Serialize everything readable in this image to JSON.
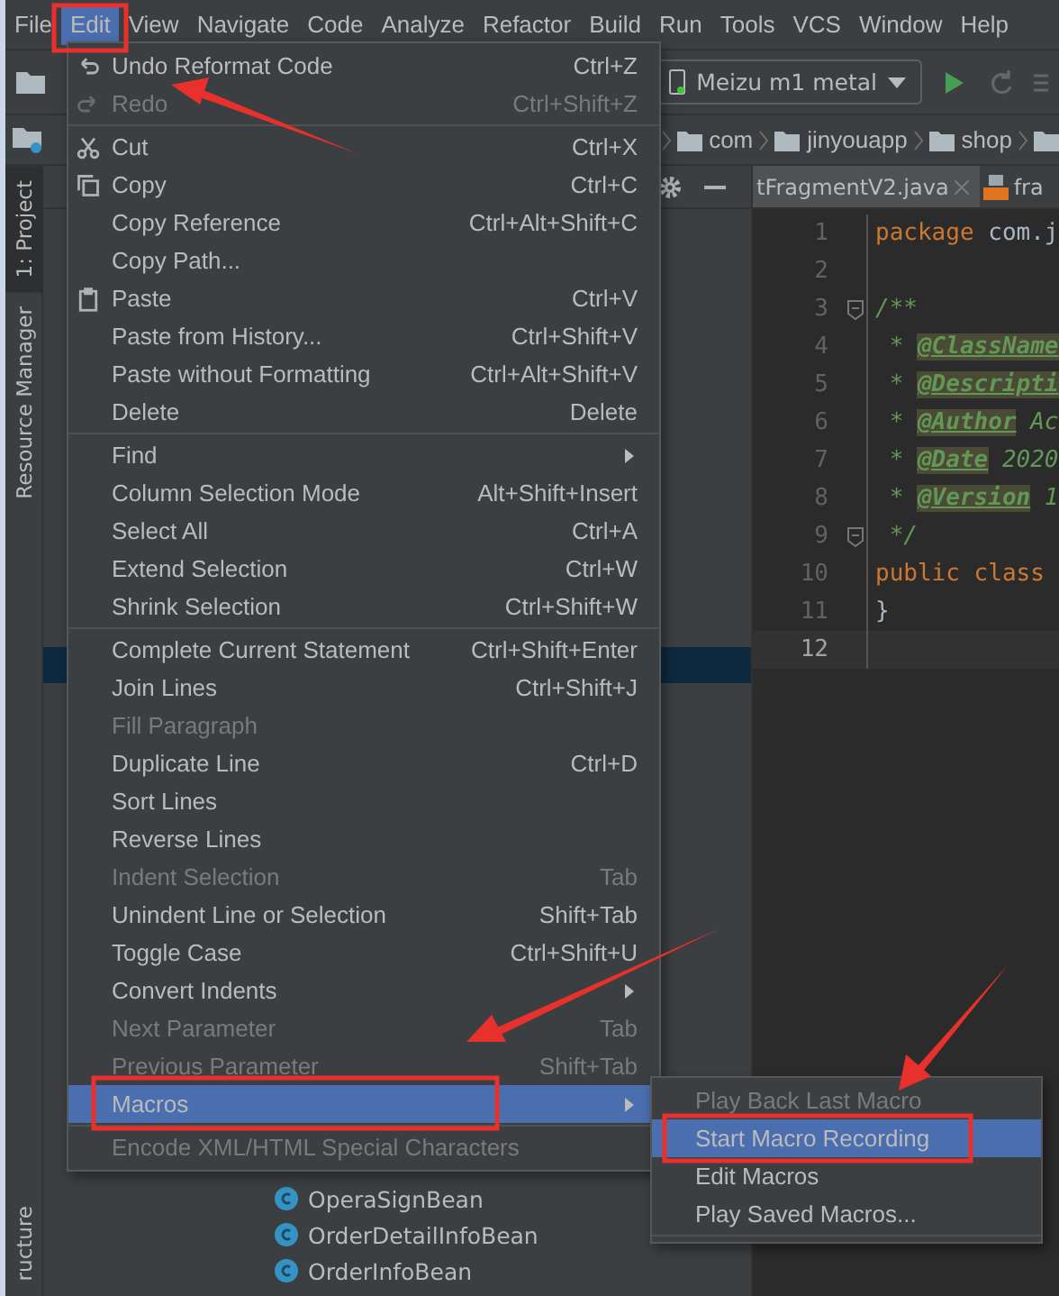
{
  "menu_bar": [
    {
      "label": "File",
      "selected": false
    },
    {
      "label": "Edit",
      "selected": true
    },
    {
      "label": "View",
      "selected": false
    },
    {
      "label": "Navigate",
      "selected": false
    },
    {
      "label": "Code",
      "selected": false
    },
    {
      "label": "Analyze",
      "selected": false
    },
    {
      "label": "Refactor",
      "selected": false
    },
    {
      "label": "Build",
      "selected": false
    },
    {
      "label": "Run",
      "selected": false
    },
    {
      "label": "Tools",
      "selected": false
    },
    {
      "label": "VCS",
      "selected": false
    },
    {
      "label": "Window",
      "selected": false
    },
    {
      "label": "Help",
      "selected": false
    }
  ],
  "toolbar": {
    "device": "Meizu m1 metal"
  },
  "breadcrumbs": [
    "com",
    "jinyouapp",
    "shop"
  ],
  "tool_strip": {
    "top": [
      {
        "label": "1: Project",
        "selected": true
      },
      {
        "label": "Resource Manager",
        "selected": false
      }
    ],
    "bottom": [
      {
        "label": "ructure",
        "selected": false
      }
    ]
  },
  "project_panel": {
    "highlighted_row": {
      "selected": true
    },
    "classes": [
      {
        "label": "OperaSignBean"
      },
      {
        "label": "OrderDetailInfoBean"
      },
      {
        "label": "OrderInfoBean"
      }
    ]
  },
  "editor": {
    "tabs": [
      {
        "label": "tFragmentV2.java",
        "selected": true,
        "closable": true,
        "kind": "java"
      },
      {
        "label": "fra",
        "selected": false,
        "closable": false,
        "kind": "layout"
      }
    ],
    "lines": [
      {
        "number": "1",
        "current": false,
        "segments": [
          {
            "kind": "keyword",
            "text": "package"
          },
          {
            "kind": "plain",
            "text": " com.j"
          }
        ]
      },
      {
        "number": "2",
        "current": false
      },
      {
        "number": "3",
        "current": false,
        "fold": true,
        "segments": [
          {
            "kind": "comment",
            "text": "/**"
          }
        ]
      },
      {
        "number": "4",
        "current": false,
        "segments": [
          {
            "kind": "comment",
            "text": " * "
          },
          {
            "kind": "tag",
            "text": "@ClassName"
          }
        ]
      },
      {
        "number": "5",
        "current": false,
        "segments": [
          {
            "kind": "comment",
            "text": " * "
          },
          {
            "kind": "tag",
            "text": "@Descripti"
          }
        ]
      },
      {
        "number": "6",
        "current": false,
        "segments": [
          {
            "kind": "comment",
            "text": " * "
          },
          {
            "kind": "tag",
            "text": "@Author"
          },
          {
            "kind": "comment",
            "text": " Ac"
          }
        ]
      },
      {
        "number": "7",
        "current": false,
        "segments": [
          {
            "kind": "comment",
            "text": " * "
          },
          {
            "kind": "tag",
            "text": "@Date"
          },
          {
            "kind": "comment",
            "text": " 2020"
          }
        ]
      },
      {
        "number": "8",
        "current": false,
        "segments": [
          {
            "kind": "comment",
            "text": " * "
          },
          {
            "kind": "tag",
            "text": "@Version"
          },
          {
            "kind": "comment",
            "text": " 1"
          }
        ]
      },
      {
        "number": "9",
        "current": false,
        "fold": true,
        "segments": [
          {
            "kind": "comment",
            "text": " */"
          }
        ]
      },
      {
        "number": "10",
        "current": false,
        "segments": [
          {
            "kind": "keyword",
            "text": "public class"
          }
        ]
      },
      {
        "number": "11",
        "current": false,
        "segments": [
          {
            "kind": "plain",
            "text": "}"
          }
        ]
      },
      {
        "number": "12",
        "current": true
      }
    ]
  },
  "edit_menu": {
    "items": [
      {
        "kind": "item",
        "label": "Undo Reformat Code",
        "shortcut": "Ctrl+Z",
        "disabled": false,
        "selected": false,
        "submenu": false
      },
      {
        "kind": "item",
        "label": "Redo",
        "shortcut": "Ctrl+Shift+Z",
        "disabled": true,
        "selected": false,
        "submenu": false
      },
      {
        "kind": "separator"
      },
      {
        "kind": "item",
        "label": "Cut",
        "shortcut": "Ctrl+X",
        "disabled": false,
        "selected": false,
        "submenu": false
      },
      {
        "kind": "item",
        "label": "Copy",
        "shortcut": "Ctrl+C",
        "disabled": false,
        "selected": false,
        "submenu": false
      },
      {
        "kind": "item",
        "label": "Copy Reference",
        "shortcut": "Ctrl+Alt+Shift+C",
        "disabled": false,
        "selected": false,
        "submenu": false
      },
      {
        "kind": "item",
        "label": "Copy Path...",
        "disabled": false,
        "selected": false,
        "submenu": false
      },
      {
        "kind": "item",
        "label": "Paste",
        "shortcut": "Ctrl+V",
        "disabled": false,
        "selected": false,
        "submenu": false
      },
      {
        "kind": "item",
        "label": "Paste from History...",
        "shortcut": "Ctrl+Shift+V",
        "disabled": false,
        "selected": false,
        "submenu": false
      },
      {
        "kind": "item",
        "label": "Paste without Formatting",
        "shortcut": "Ctrl+Alt+Shift+V",
        "disabled": false,
        "selected": false,
        "submenu": false
      },
      {
        "kind": "item",
        "label": "Delete",
        "shortcut": "Delete",
        "disabled": false,
        "selected": false,
        "submenu": false
      },
      {
        "kind": "separator"
      },
      {
        "kind": "item",
        "label": "Find",
        "disabled": false,
        "selected": false,
        "submenu": true
      },
      {
        "kind": "item",
        "label": "Column Selection Mode",
        "shortcut": "Alt+Shift+Insert",
        "disabled": false,
        "selected": false,
        "submenu": false
      },
      {
        "kind": "item",
        "label": "Select All",
        "shortcut": "Ctrl+A",
        "disabled": false,
        "selected": false,
        "submenu": false
      },
      {
        "kind": "item",
        "label": "Extend Selection",
        "shortcut": "Ctrl+W",
        "disabled": false,
        "selected": false,
        "submenu": false
      },
      {
        "kind": "item",
        "label": "Shrink Selection",
        "shortcut": "Ctrl+Shift+W",
        "disabled": false,
        "selected": false,
        "submenu": false
      },
      {
        "kind": "separator"
      },
      {
        "kind": "item",
        "label": "Complete Current Statement",
        "shortcut": "Ctrl+Shift+Enter",
        "disabled": false,
        "selected": false,
        "submenu": false
      },
      {
        "kind": "item",
        "label": "Join Lines",
        "shortcut": "Ctrl+Shift+J",
        "disabled": false,
        "selected": false,
        "submenu": false
      },
      {
        "kind": "item",
        "label": "Fill Paragraph",
        "disabled": true,
        "selected": false,
        "submenu": false
      },
      {
        "kind": "item",
        "label": "Duplicate Line",
        "shortcut": "Ctrl+D",
        "disabled": false,
        "selected": false,
        "submenu": false
      },
      {
        "kind": "item",
        "label": "Sort Lines",
        "disabled": false,
        "selected": false,
        "submenu": false
      },
      {
        "kind": "item",
        "label": "Reverse Lines",
        "disabled": false,
        "selected": false,
        "submenu": false
      },
      {
        "kind": "item",
        "label": "Indent Selection",
        "shortcut": "Tab",
        "disabled": true,
        "selected": false,
        "submenu": false
      },
      {
        "kind": "item",
        "label": "Unindent Line or Selection",
        "shortcut": "Shift+Tab",
        "disabled": false,
        "selected": false,
        "submenu": false
      },
      {
        "kind": "item",
        "label": "Toggle Case",
        "shortcut": "Ctrl+Shift+U",
        "disabled": false,
        "selected": false,
        "submenu": false
      },
      {
        "kind": "item",
        "label": "Convert Indents",
        "disabled": false,
        "selected": false,
        "submenu": true
      },
      {
        "kind": "item",
        "label": "Next Parameter",
        "shortcut": "Tab",
        "disabled": true,
        "selected": false,
        "submenu": false
      },
      {
        "kind": "item",
        "label": "Previous Parameter",
        "shortcut": "Shift+Tab",
        "disabled": true,
        "selected": false,
        "submenu": false
      },
      {
        "kind": "item",
        "label": "Macros",
        "disabled": false,
        "selected": true,
        "submenu": true
      },
      {
        "kind": "separator"
      },
      {
        "kind": "item",
        "label": "Encode XML/HTML Special Characters",
        "disabled": true,
        "selected": false,
        "submenu": false
      }
    ]
  },
  "macros_submenu": {
    "items": [
      {
        "kind": "item",
        "label": "Play Back Last Macro",
        "disabled": true,
        "selected": false
      },
      {
        "kind": "item",
        "label": "Start Macro Recording",
        "disabled": false,
        "selected": true
      },
      {
        "kind": "item",
        "label": "Edit Macros",
        "disabled": false,
        "selected": false
      },
      {
        "kind": "item",
        "label": "Play Saved Macros...",
        "disabled": false,
        "selected": false
      },
      {
        "kind": "separator"
      }
    ]
  }
}
